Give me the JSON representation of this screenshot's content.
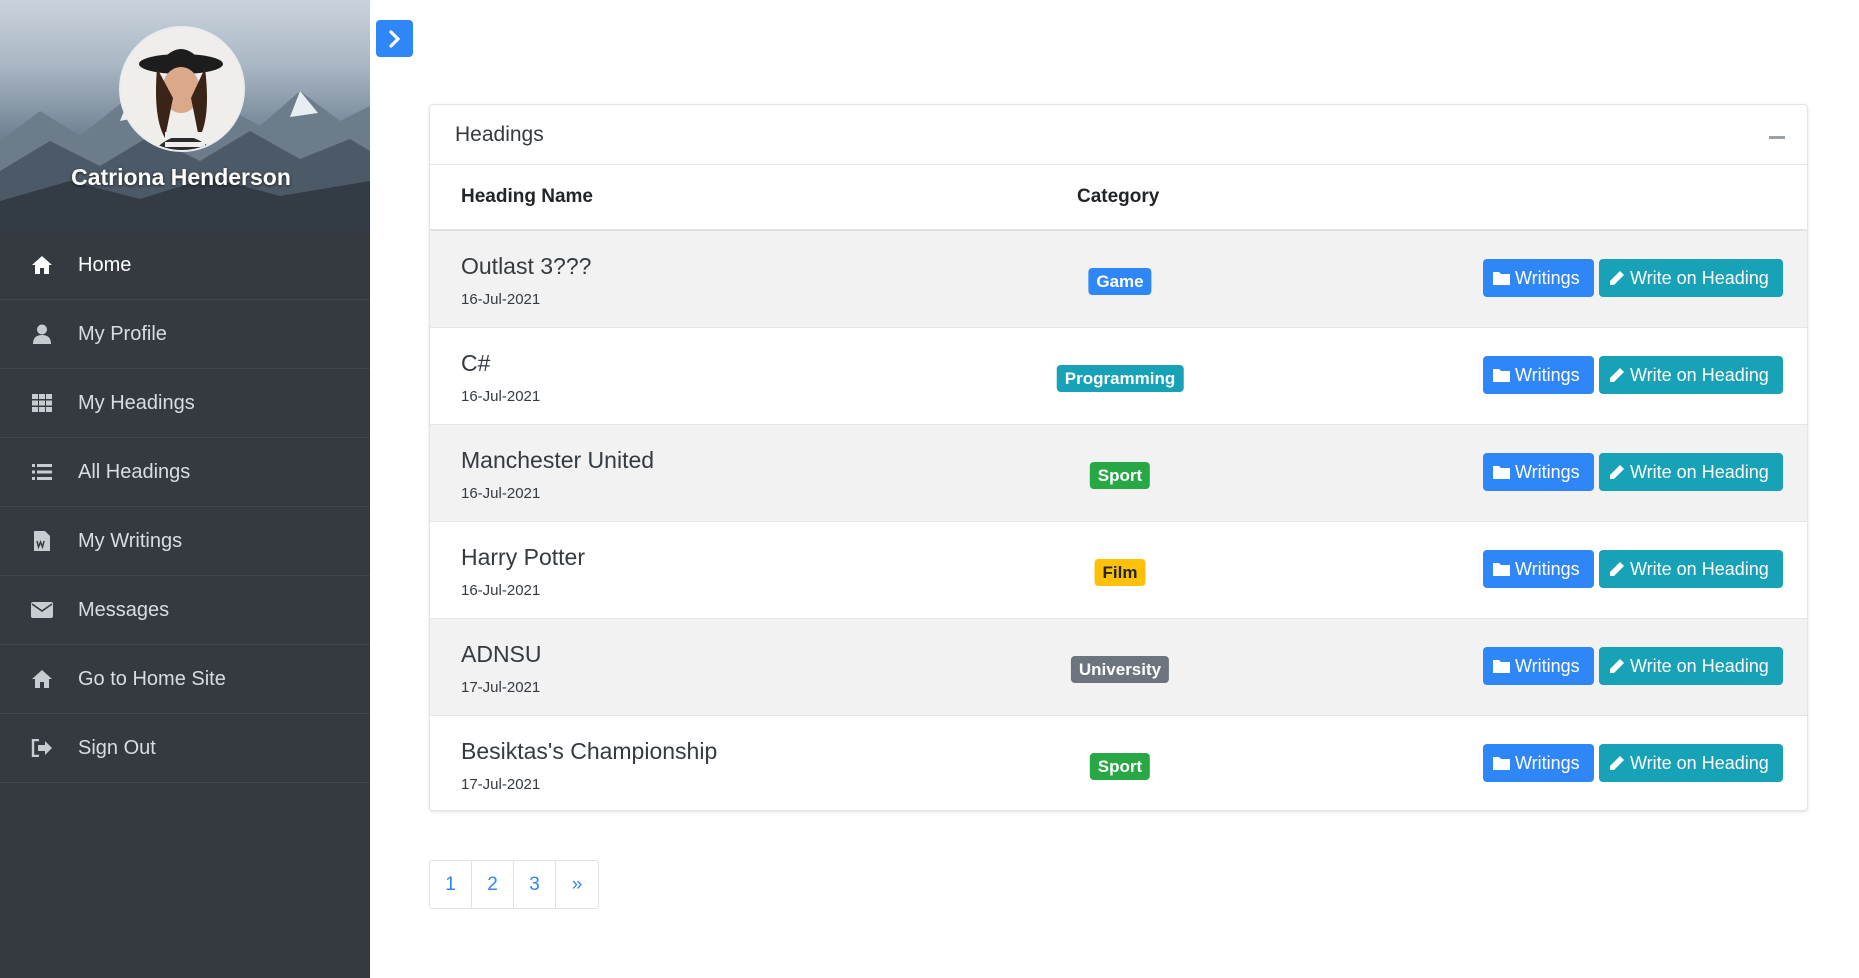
{
  "profile": {
    "name": "Catriona Henderson"
  },
  "sidebar": {
    "items": [
      {
        "label": "Home",
        "icon": "home-icon",
        "active": true
      },
      {
        "label": "My Profile",
        "icon": "user-icon",
        "active": false
      },
      {
        "label": "My Headings",
        "icon": "grid-icon",
        "active": false
      },
      {
        "label": "All Headings",
        "icon": "list-icon",
        "active": false
      },
      {
        "label": "My Writings",
        "icon": "word-file-icon",
        "active": false
      },
      {
        "label": "Messages",
        "icon": "envelope-icon",
        "active": false
      },
      {
        "label": "Go to Home Site",
        "icon": "home-icon",
        "active": false
      },
      {
        "label": "Sign Out",
        "icon": "sign-out-icon",
        "active": false
      }
    ]
  },
  "card": {
    "title": "Headings",
    "columns": {
      "name": "Heading Name",
      "category": "Category"
    },
    "button_labels": {
      "writings": "Writings",
      "write": "Write on Heading"
    },
    "rows": [
      {
        "title": "Outlast 3???",
        "date": "16-Jul-2021",
        "category": "Game",
        "category_color": "#2f86f6",
        "category_text": "#ffffff"
      },
      {
        "title": "C#",
        "date": "16-Jul-2021",
        "category": "Programming",
        "category_color": "#17a2b8",
        "category_text": "#ffffff"
      },
      {
        "title": "Manchester United",
        "date": "16-Jul-2021",
        "category": "Sport",
        "category_color": "#28a745",
        "category_text": "#ffffff"
      },
      {
        "title": "Harry Potter",
        "date": "16-Jul-2021",
        "category": "Film",
        "category_color": "#ffc107",
        "category_text": "#212529"
      },
      {
        "title": "ADNSU",
        "date": "17-Jul-2021",
        "category": "University",
        "category_color": "#6c757d",
        "category_text": "#ffffff"
      },
      {
        "title": "Besiktas's Championship",
        "date": "17-Jul-2021",
        "category": "Sport",
        "category_color": "#28a745",
        "category_text": "#ffffff"
      }
    ]
  },
  "pagination": {
    "pages": [
      "1",
      "2",
      "3",
      "»"
    ]
  },
  "colors": {
    "sidebar_bg": "#343a40",
    "primary": "#2f86f6",
    "info": "#17a2b8"
  }
}
